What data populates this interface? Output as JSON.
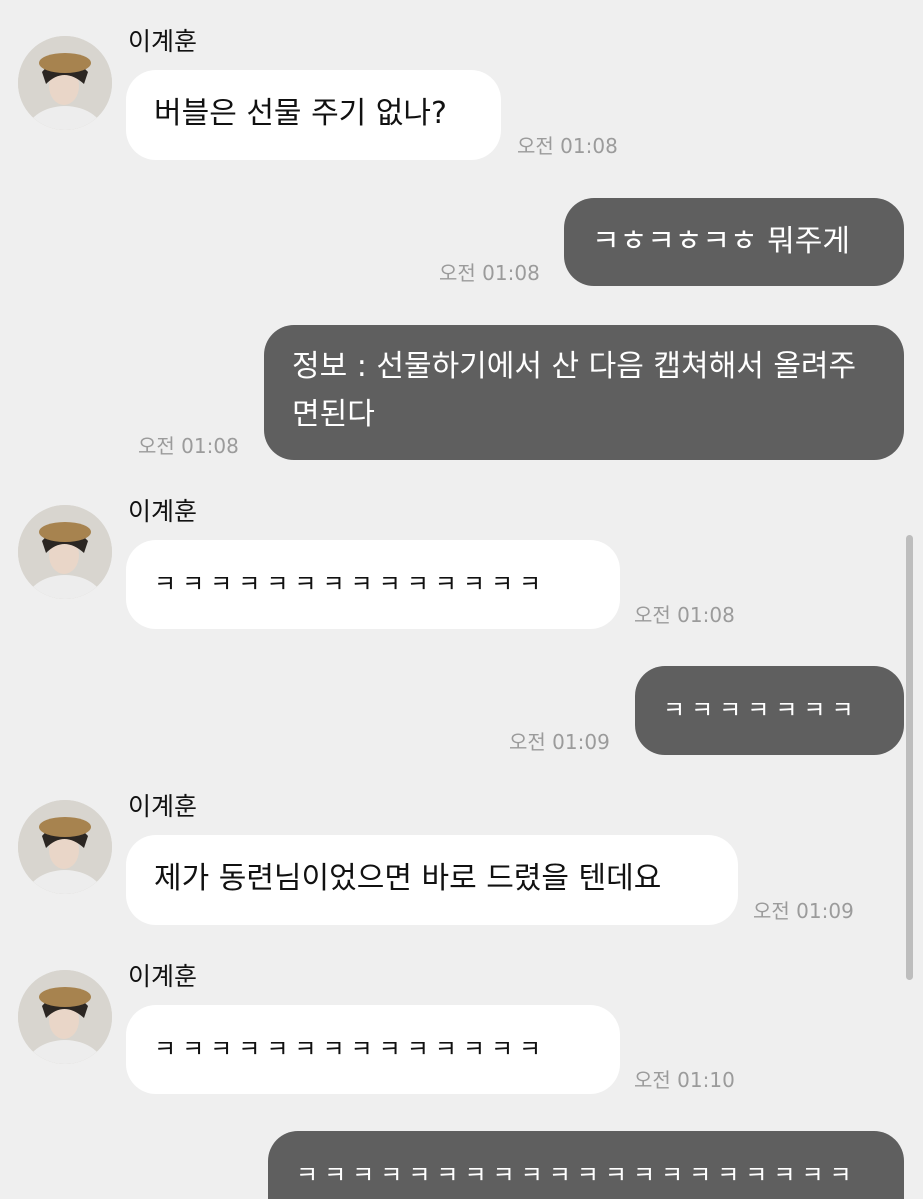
{
  "contact": {
    "name": "이계훈"
  },
  "messages": [
    {
      "dir": "in",
      "text": "버블은 선물 주기 없나?",
      "time": "오전 01:08"
    },
    {
      "dir": "out",
      "text": "ㅋㅎㅋㅎㅋㅎ 뭐주게",
      "time": "오전 01:08"
    },
    {
      "dir": "out",
      "text": "정보 : 선물하기에서 산 다음 캡쳐해서 올려주면된다",
      "time": "오전 01:08"
    },
    {
      "dir": "in",
      "text": "ㅋㅋㅋㅋㅋㅋㅋㅋㅋㅋㅋㅋㅋㅋ",
      "time": "오전 01:08"
    },
    {
      "dir": "out",
      "text": "ㅋㅋㅋㅋㅋㅋㅋ",
      "time": "오전 01:09"
    },
    {
      "dir": "in",
      "text": "제가 동련님이었으면 바로 드렸을 텐데요",
      "time": "오전 01:09"
    },
    {
      "dir": "in",
      "text": "ㅋㅋㅋㅋㅋㅋㅋㅋㅋㅋㅋㅋㅋㅋ",
      "time": "오전 01:10"
    },
    {
      "dir": "out",
      "text": "ㅋㅋㅋㅋㅋㅋㅋㅋㅋㅋㅋㅋㅋㅋㅋㅋㅋㅋㅋㅋ",
      "time": ""
    }
  ],
  "colors": {
    "background": "#efefef",
    "incoming_bubble": "#ffffff",
    "outgoing_bubble": "#5f5f5f",
    "timestamp": "#9b9b9b"
  }
}
